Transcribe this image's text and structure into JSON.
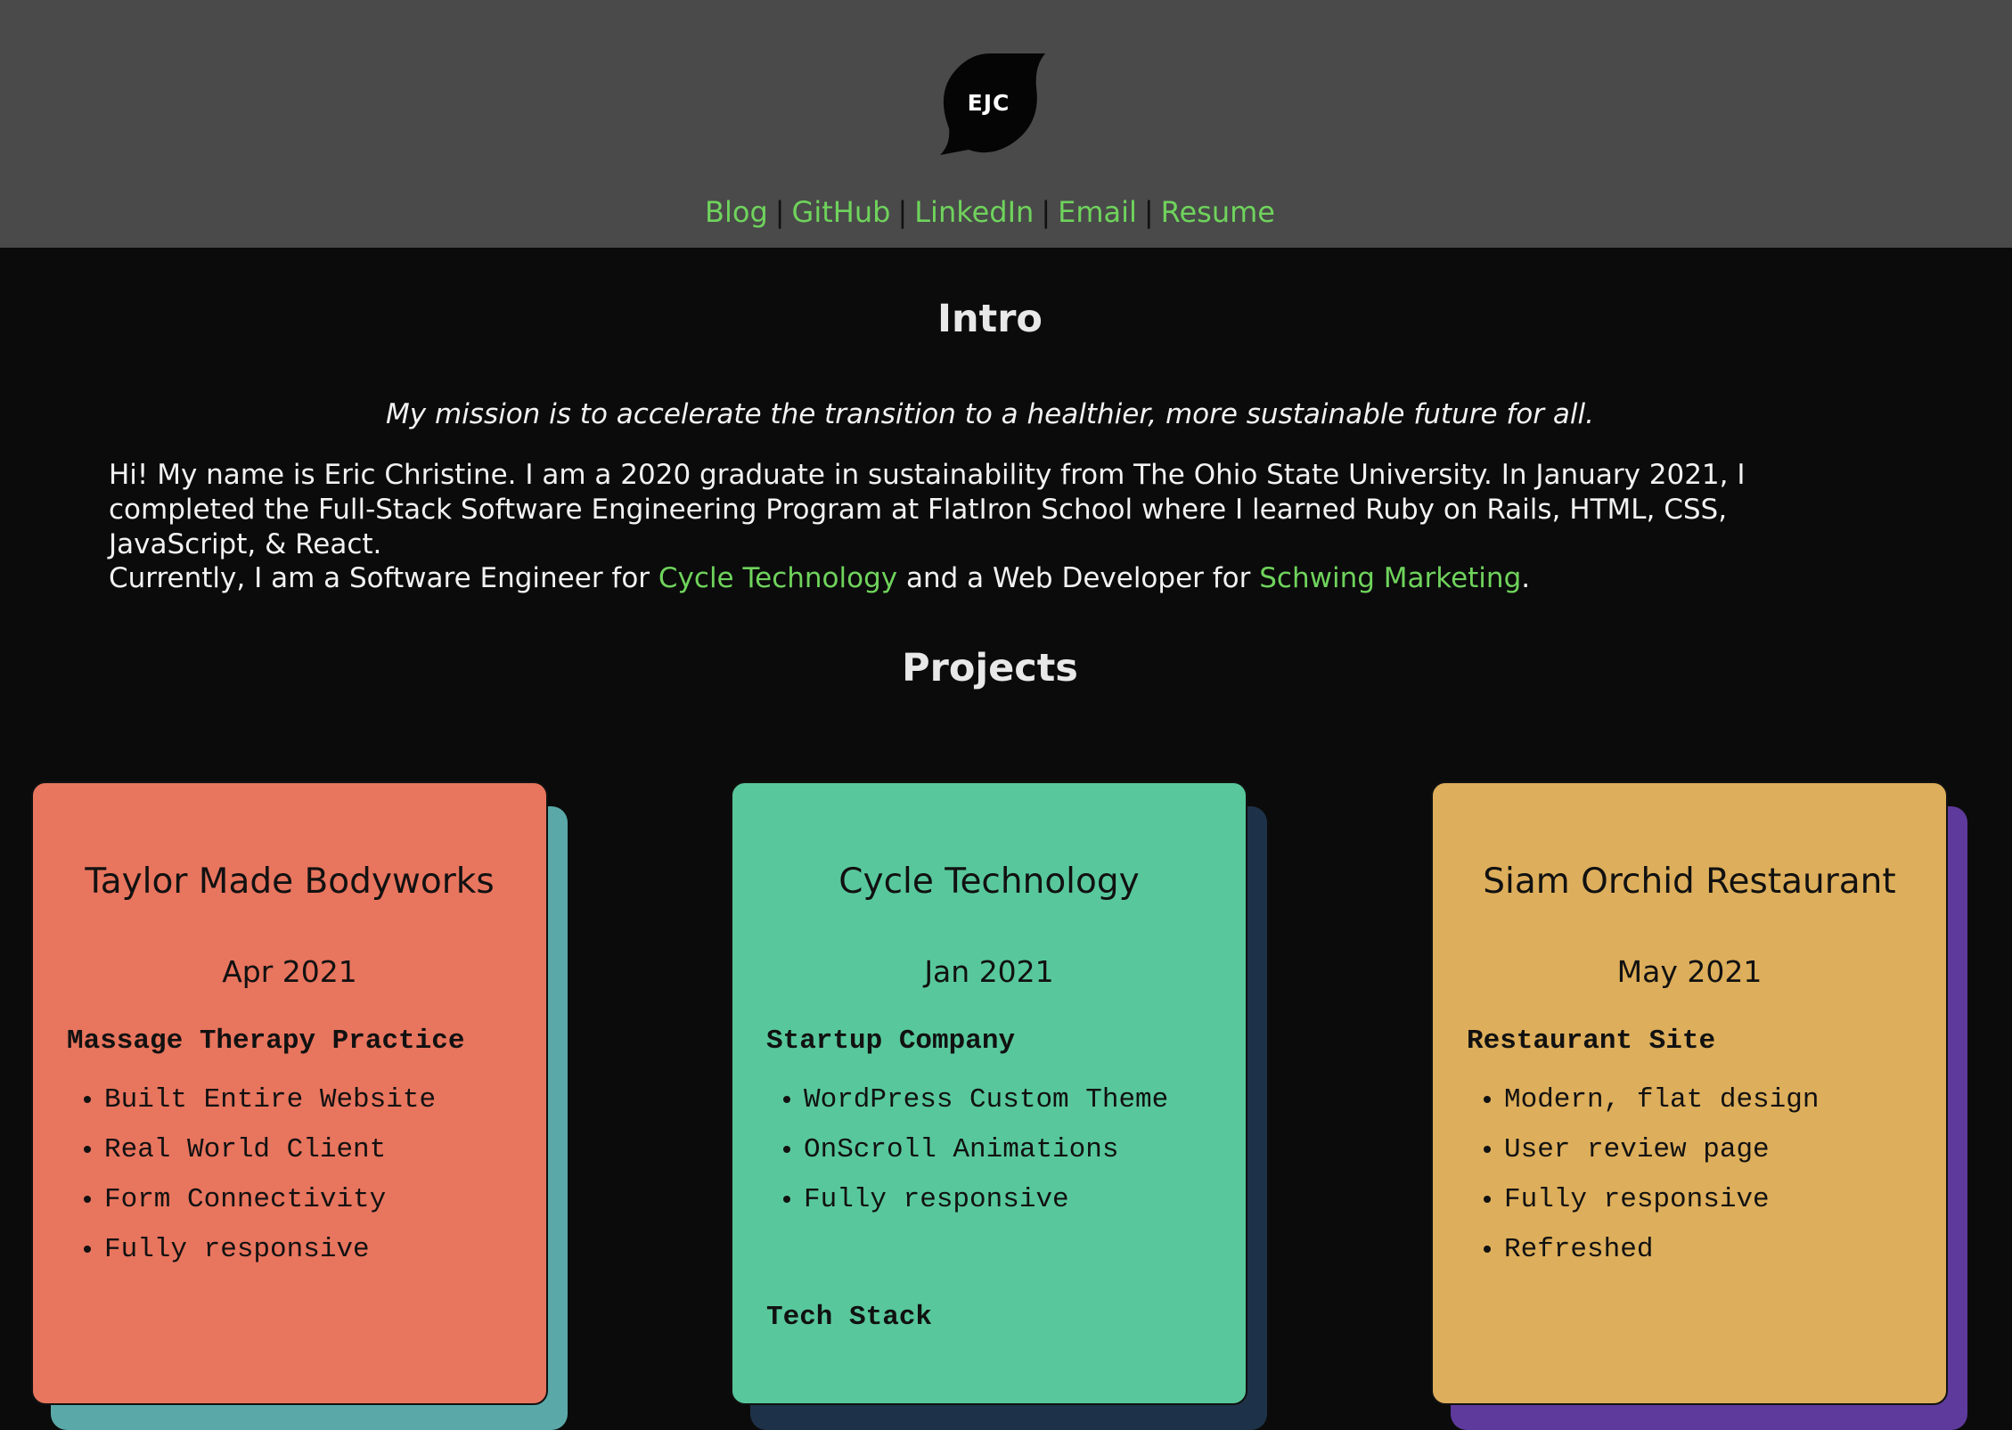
{
  "header": {
    "logo_text": "EJC",
    "nav": [
      {
        "label": "Blog"
      },
      {
        "label": "GitHub"
      },
      {
        "label": "LinkedIn"
      },
      {
        "label": "Email"
      },
      {
        "label": "Resume"
      }
    ],
    "separator": "|"
  },
  "intro": {
    "title": "Intro",
    "mission": "My mission is to accelerate the transition to a healthier, more sustainable future for all.",
    "paragraph1": "Hi! My name is Eric Christine. I am a 2020 graduate in sustainability from The Ohio State University. In January 2021, I completed the Full-Stack Software Engineering Program at FlatIron School where I learned Ruby on Rails, HTML, CSS, JavaScript, & React.",
    "paragraph2_prefix": "Currently, I am a Software Engineer for ",
    "paragraph2_link1": "Cycle Technology",
    "paragraph2_middle": " and a Web Developer for ",
    "paragraph2_link2": "Schwing Marketing",
    "paragraph2_suffix": "."
  },
  "projects": {
    "title": "Projects",
    "cards": [
      {
        "title": "Taylor Made Bodyworks",
        "date": "Apr 2021",
        "subtitle": "Massage Therapy Practice",
        "bullets": [
          "Built Entire Website",
          "Real World Client",
          "Form Connectivity",
          "Fully responsive"
        ],
        "stack_label": "",
        "color": "#e8755e",
        "back_color": "#5aa9a8"
      },
      {
        "title": "Cycle Technology",
        "date": "Jan 2021",
        "subtitle": "Startup Company",
        "bullets": [
          "WordPress Custom Theme",
          "OnScroll Animations",
          "Fully responsive"
        ],
        "stack_label": "Tech Stack",
        "color": "#58c89c",
        "back_color": "#1d3248"
      },
      {
        "title": "Siam Orchid Restaurant",
        "date": "May 2021",
        "subtitle": "Restaurant Site",
        "bullets": [
          "Modern, flat design",
          "User review page",
          "Fully responsive",
          "Refreshed"
        ],
        "stack_label": "",
        "color": "#ddae5b",
        "back_color": "#5e3a9c"
      }
    ]
  },
  "colors": {
    "header_bg": "#4a4a4a",
    "page_bg": "#0b0b0b",
    "link": "#6fd35c"
  }
}
